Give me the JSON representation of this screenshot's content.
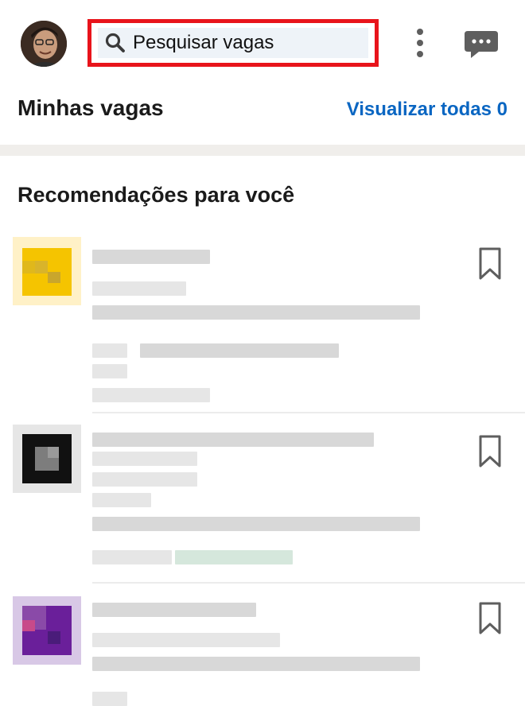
{
  "header": {
    "search": {
      "placeholder": "Pesquisar vagas",
      "value": "",
      "highlight_color": "#e8141b",
      "background_color": "#eef3f8"
    },
    "icons": [
      "profile-avatar",
      "search-icon",
      "more-options-icon",
      "messaging-icon"
    ]
  },
  "my_jobs": {
    "title": "Minhas vagas",
    "view_all_label": "Visualizar todas 0",
    "link_color": "#0a66c2"
  },
  "recommendations": {
    "title": "Recomendações para você",
    "jobs": [
      {
        "logo_color": "#f5c400",
        "saved": false
      },
      {
        "logo_color": "#111111",
        "saved": false
      },
      {
        "logo_color": "#5a1a8c",
        "saved": false
      }
    ]
  }
}
